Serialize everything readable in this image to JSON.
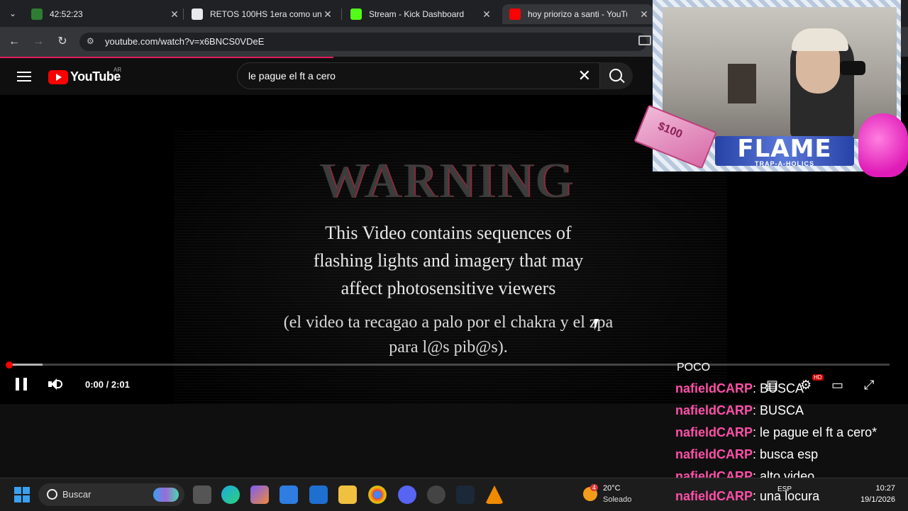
{
  "browser": {
    "tabs": [
      {
        "label": "42:52:23",
        "icon": "timer-icon",
        "active": false
      },
      {
        "label": "RETOS 100HS 1era como un lin",
        "icon": "sheet-icon",
        "active": false
      },
      {
        "label": "Stream - Kick Dashboard",
        "icon": "kick-icon",
        "active": false
      },
      {
        "label": "hoy priorizo a santi - YouTu",
        "icon": "youtube-icon",
        "active": true
      }
    ],
    "url": "youtube.com/watch?v=x6BNCS0VDeE"
  },
  "youtube": {
    "logo_text": "YouTube",
    "country": "AR",
    "search_value": "le pague el ft a cero"
  },
  "video": {
    "warning_title": "WARNING",
    "warning_lines": [
      "This Video contains sequences of",
      "flashing lights and imagery that may",
      "affect photosensitive viewers"
    ],
    "note_lines": [
      "(el video ta recagao a palo por el chakra y el zpa",
      "para l@s pib@s)."
    ],
    "time": "0:00 / 2:01",
    "progress": 0.0,
    "hd_badge": "HD"
  },
  "overlay": {
    "banner_title": "FLAME",
    "banner_subtitle": "TRAP-A-HOLICS",
    "money_text": "$100"
  },
  "chat": {
    "header_fragment": "POCO",
    "messages": [
      {
        "user": "nafieldCARP",
        "text": "BUSCA"
      },
      {
        "user": "nafieldCARP",
        "text": "BUSCA"
      },
      {
        "user": "nafieldCARP",
        "text": "le pague el ft a cero*"
      },
      {
        "user": "nafieldCARP",
        "text": "busca esp"
      },
      {
        "user": "nafieldCARP",
        "text": "alto video"
      },
      {
        "user": "nafieldCARP",
        "text": "una locura"
      }
    ],
    "user_color": "#ff4fa8"
  },
  "taskbar": {
    "search_placeholder": "Buscar",
    "weather_temp": "20°C",
    "weather_desc": "Soleado",
    "weather_badge": "4",
    "language": "ESP",
    "time": "10:27",
    "date": "19/1/2026",
    "accent": "#3aa0f0"
  }
}
